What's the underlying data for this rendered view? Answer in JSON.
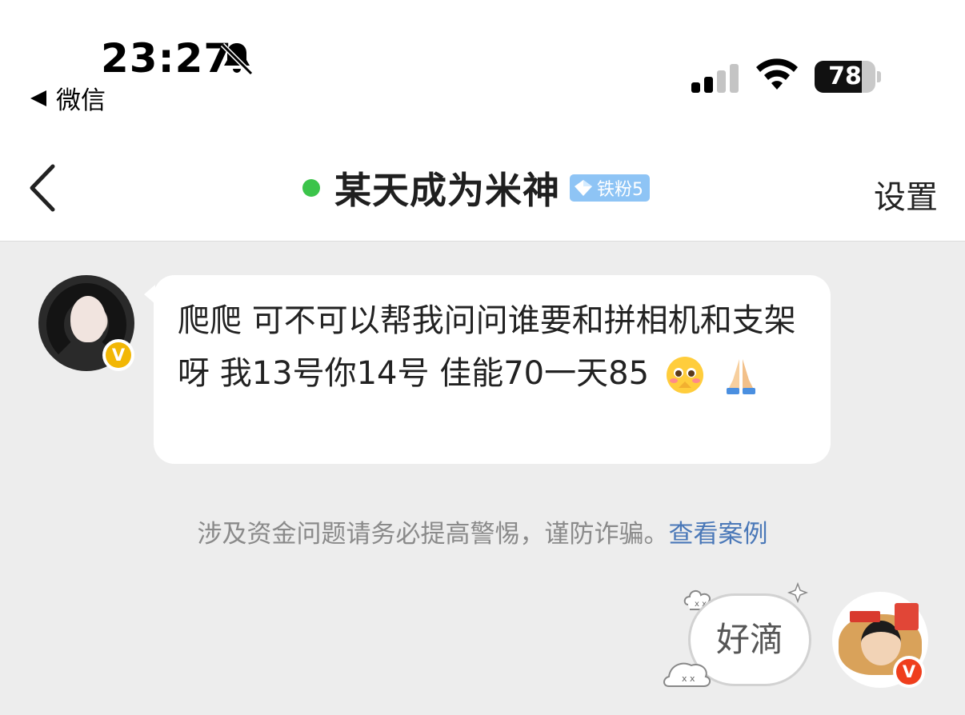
{
  "status_bar": {
    "time": "23:27",
    "back_app_label": "微信",
    "battery_level": "78",
    "battery_fraction": 0.78,
    "icons": [
      "bell-muted-icon",
      "signal-icon",
      "wifi-icon",
      "battery-icon"
    ]
  },
  "nav": {
    "title": "某天成为米神",
    "fan_badge": "铁粉5",
    "settings_label": "设置",
    "online_color": "#3bc44a",
    "badge_color": "#8ec4f5"
  },
  "messages": [
    {
      "side": "left",
      "text": "爬爬 可不可以帮我问问谁要和拼相机和支架呀 我13号你14号 佳能70一天85",
      "emojis": [
        "pleading-face-emoji",
        "folded-hands-emoji"
      ]
    }
  ],
  "notice": {
    "text": "涉及资金问题请务必提高警惕，谨防诈骗。",
    "link": "查看案例",
    "link_color": "#4a78b8"
  },
  "reply_sticker": {
    "text": "好滴"
  },
  "avatars": {
    "verified_badge_letter": "V"
  }
}
